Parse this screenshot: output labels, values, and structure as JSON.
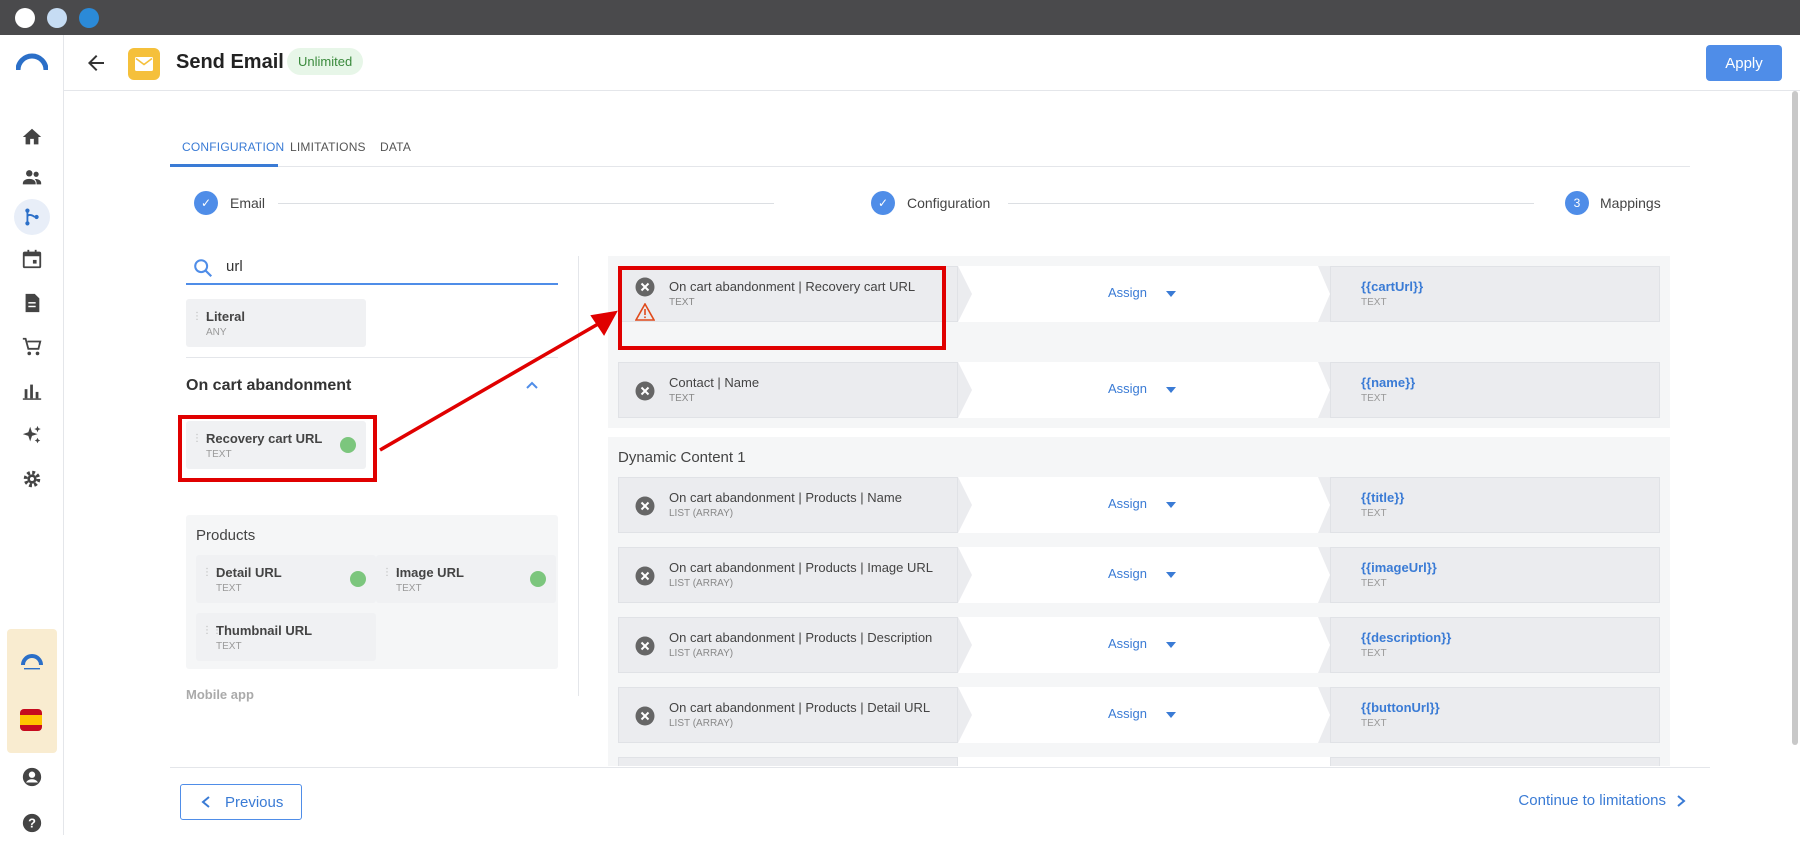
{
  "header": {
    "title": "Send Email",
    "badge": "Unlimited",
    "apply_label": "Apply"
  },
  "tabs": [
    {
      "label": "CONFIGURATION",
      "active": true
    },
    {
      "label": "LIMITATIONS",
      "active": false
    },
    {
      "label": "DATA",
      "active": false
    }
  ],
  "stepper": [
    {
      "label": "Email",
      "state": "done"
    },
    {
      "label": "Configuration",
      "state": "done"
    },
    {
      "label": "Mappings",
      "number": "3",
      "state": "current"
    }
  ],
  "search": {
    "value": "url"
  },
  "left": {
    "literal": {
      "name": "Literal",
      "type": "ANY"
    },
    "group_title": "On cart abandonment",
    "recovery": {
      "name": "Recovery cart URL",
      "type": "TEXT"
    },
    "products_title": "Products",
    "products": [
      {
        "name": "Detail URL",
        "type": "TEXT",
        "checked": true
      },
      {
        "name": "Image URL",
        "type": "TEXT",
        "checked": true
      },
      {
        "name": "Thumbnail URL",
        "type": "TEXT",
        "checked": false
      }
    ],
    "mobile_app": "Mobile app"
  },
  "mappings_top": [
    {
      "source": "On cart abandonment | Recovery cart URL",
      "source_type": "TEXT",
      "action": "Assign",
      "target": "{{cartUrl}}",
      "target_type": "TEXT",
      "warning": true
    },
    {
      "source": "Contact | Name",
      "source_type": "TEXT",
      "action": "Assign",
      "target": "{{name}}",
      "target_type": "TEXT",
      "warning": false
    }
  ],
  "dynamic_title": "Dynamic Content 1",
  "mappings_dynamic": [
    {
      "source": "On cart abandonment | Products | Name",
      "source_type": "LIST (ARRAY)",
      "action": "Assign",
      "target": "{{title}}",
      "target_type": "TEXT"
    },
    {
      "source": "On cart abandonment | Products | Image URL",
      "source_type": "LIST (ARRAY)",
      "action": "Assign",
      "target": "{{imageUrl}}",
      "target_type": "TEXT"
    },
    {
      "source": "On cart abandonment | Products | Description",
      "source_type": "LIST (ARRAY)",
      "action": "Assign",
      "target": "{{description}}",
      "target_type": "TEXT"
    },
    {
      "source": "On cart abandonment | Products | Detail URL",
      "source_type": "LIST (ARRAY)",
      "action": "Assign",
      "target": "{{buttonUrl}}",
      "target_type": "TEXT"
    }
  ],
  "footer": {
    "previous_label": "Previous",
    "next_label": "Continue to limitations"
  },
  "colors": {
    "accent": "#4f8de8",
    "link": "#3a7bd5",
    "badge_bg": "#e7f6e8",
    "badge_text": "#3a8a3c",
    "highlight": "#e00000",
    "email_icon": "#f5c03b"
  }
}
